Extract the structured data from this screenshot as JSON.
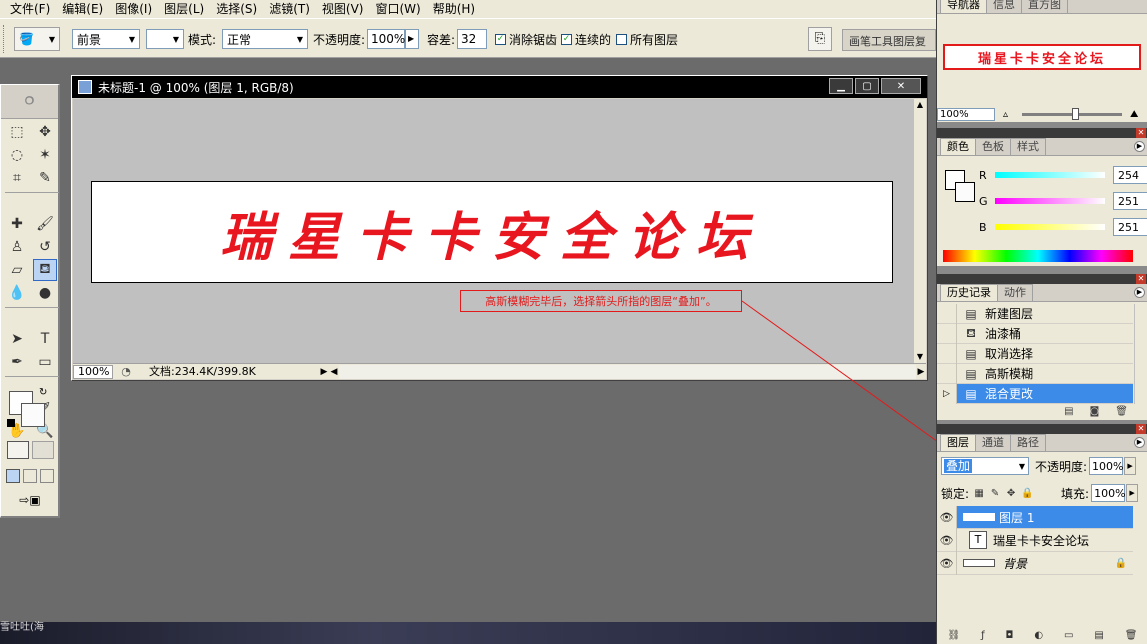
{
  "menubar": [
    "文件(F)",
    "编辑(E)",
    "图像(I)",
    "图层(L)",
    "选择(S)",
    "滤镜(T)",
    "视图(V)",
    "窗口(W)",
    "帮助(H)"
  ],
  "options": {
    "fill_source": "前景",
    "mode_label": "模式:",
    "mode_value": "正常",
    "opacity_label": "不透明度:",
    "opacity_value": "100%",
    "tolerance_label": "容差:",
    "tolerance_value": "32",
    "anti_alias": "消除锯齿",
    "contiguous": "连续的",
    "all_layers": "所有图层",
    "palette_well": "画笔工具图层复"
  },
  "document": {
    "title": "未标题-1 @ 100% (图层 1, RGB/8)",
    "canvas_text": "瑞星卡卡安全论坛",
    "zoom": "100%",
    "doc_size": "文档:234.4K/399.8K"
  },
  "annotation": "高斯模糊完毕后，选择箭头所指的图层“叠加”。",
  "navigator": {
    "tabs": [
      "导航器",
      "信息",
      "直方图"
    ],
    "thumb_text": "瑞星卡卡安全论坛",
    "zoom": "100%"
  },
  "color_panel": {
    "tabs": [
      "颜色",
      "色板",
      "样式"
    ],
    "channels": [
      {
        "label": "R",
        "value": "254"
      },
      {
        "label": "G",
        "value": "251"
      },
      {
        "label": "B",
        "value": "251"
      }
    ]
  },
  "history_panel": {
    "tabs": [
      "历史记录",
      "动作"
    ],
    "items": [
      "新建图层",
      "油漆桶",
      "取消选择",
      "高斯模糊",
      "混合更改"
    ]
  },
  "layers_panel": {
    "tabs": [
      "图层",
      "通道",
      "路径"
    ],
    "blend_mode": "叠加",
    "opacity_label": "不透明度:",
    "opacity_value": "100%",
    "lock_label": "锁定:",
    "fill_label": "填充:",
    "fill_value": "100%",
    "layers": [
      "图层 1",
      "瑞星卡卡安全论坛",
      "背景"
    ]
  },
  "taskstrip_text": "雪吐吐(海"
}
